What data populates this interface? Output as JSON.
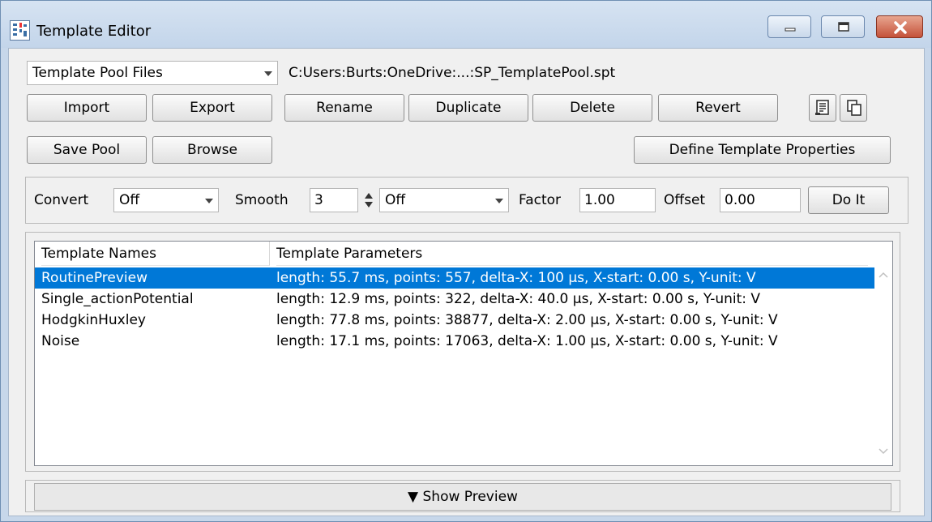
{
  "window": {
    "title": "Template Editor",
    "close_color": "#c4523a",
    "accent_color": "#0078d7"
  },
  "source": {
    "dropdown_value": "Template Pool Files",
    "path": "C:Users:Burts:OneDrive:...:SP_TemplatePool.spt"
  },
  "toolbar": {
    "import": "Import",
    "export": "Export",
    "rename": "Rename",
    "duplicate": "Duplicate",
    "delete": "Delete",
    "revert": "Revert",
    "save_pool": "Save Pool",
    "browse": "Browse",
    "define_properties": "Define Template Properties",
    "icons": [
      "notes-icon",
      "copy-icon"
    ]
  },
  "transform": {
    "convert_label": "Convert",
    "convert_value": "Off",
    "smooth_label": "Smooth",
    "smooth_value": "3",
    "smooth_mode": "Off",
    "factor_label": "Factor",
    "factor_value": "1.00",
    "offset_label": "Offset",
    "offset_value": "0.00",
    "do_it": "Do It"
  },
  "templates": {
    "columns": [
      "Template Names",
      "Template Parameters"
    ],
    "rows": [
      {
        "name": "RoutinePreview",
        "params": "length: 55.7 ms, points: 557, delta-X: 100 µs, X-start: 0.00 s, Y-unit: V",
        "selected": true
      },
      {
        "name": "Single_actionPotential",
        "params": "length: 12.9 ms, points: 322, delta-X: 40.0 µs, X-start: 0.00 s, Y-unit: V",
        "selected": false
      },
      {
        "name": "HodgkinHuxley",
        "params": "length: 77.8 ms, points: 38877, delta-X: 2.00 µs, X-start: 0.00 s, Y-unit: V",
        "selected": false
      },
      {
        "name": "Noise",
        "params": "length: 17.1 ms, points: 17063, delta-X: 1.00 µs, X-start: 0.00 s, Y-unit: V",
        "selected": false
      }
    ]
  },
  "preview": {
    "label": "▼  Show Preview"
  }
}
